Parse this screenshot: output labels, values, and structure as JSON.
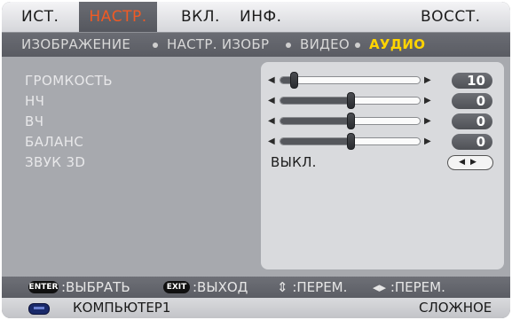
{
  "tabs": [
    {
      "label": "ИСТ.",
      "active": false
    },
    {
      "label": "НАСТР.",
      "active": true
    },
    {
      "label": "ВКЛ.",
      "active": false
    },
    {
      "label": "ИНФ.",
      "active": false
    },
    {
      "label": "ВОССТ.",
      "active": false
    }
  ],
  "subtabs": [
    {
      "label": "ИЗОБРАЖЕНИЕ",
      "active": false
    },
    {
      "label": "НАСТР. ИЗОБР",
      "active": false
    },
    {
      "label": "ВИДЕО",
      "active": false
    },
    {
      "label": "АУДИО",
      "active": true
    }
  ],
  "settings": [
    {
      "label": "ГРОМКОСТЬ",
      "value": "10",
      "fraction": 0.1
    },
    {
      "label": "НЧ",
      "value": "0",
      "fraction": 0.5
    },
    {
      "label": "ВЧ",
      "value": "0",
      "fraction": 0.5
    },
    {
      "label": "БАЛАНС",
      "value": "0",
      "fraction": 0.5
    }
  ],
  "sound3d": {
    "label": "ЗВУК 3D",
    "value": "ВЫКЛ."
  },
  "hints": {
    "enter_key": "ENTER",
    "select": ":ВЫБРАТЬ",
    "exit_key": "EXIT",
    "exit": ":ВЫХОД",
    "move_vertical": "⇕ :ПЕРЕМ.",
    "move_horizontal": "◂▸ :ПЕРЕМ."
  },
  "status": {
    "source": "КОМПЬЮТЕР1",
    "mode": "СЛОЖНОЕ"
  },
  "colors": {
    "active_tab": "#f05a24",
    "active_subtab": "#ffd400"
  }
}
